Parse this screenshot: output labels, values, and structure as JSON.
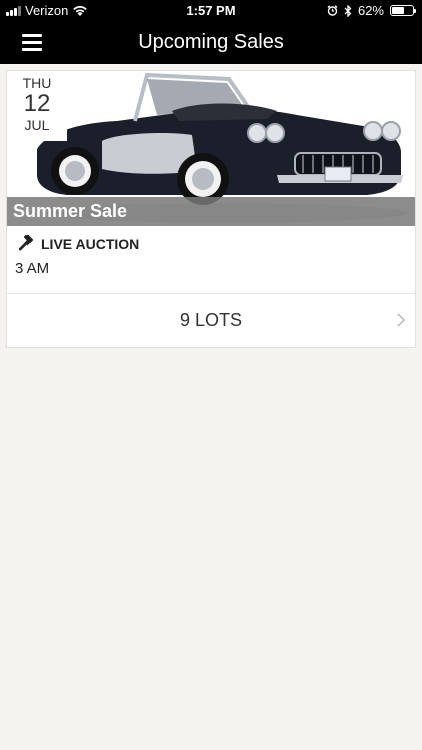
{
  "status": {
    "carrier": "Verizon",
    "time": "1:57 PM",
    "battery": "62%",
    "battery_level": 0.62
  },
  "nav": {
    "title": "Upcoming Sales"
  },
  "sale": {
    "day_of_week": "THU",
    "day": "12",
    "month": "JUL",
    "title": "Summer Sale",
    "auction_type": "LIVE AUCTION",
    "time": "3 AM",
    "lots_label": "9 LOTS"
  },
  "icons": {
    "menu": "hamburger-menu-icon",
    "wifi": "wifi-icon",
    "alarm": "alarm-icon",
    "bluetooth": "bluetooth-icon",
    "gavel": "gavel-icon",
    "chevron": "chevron-right-icon"
  }
}
